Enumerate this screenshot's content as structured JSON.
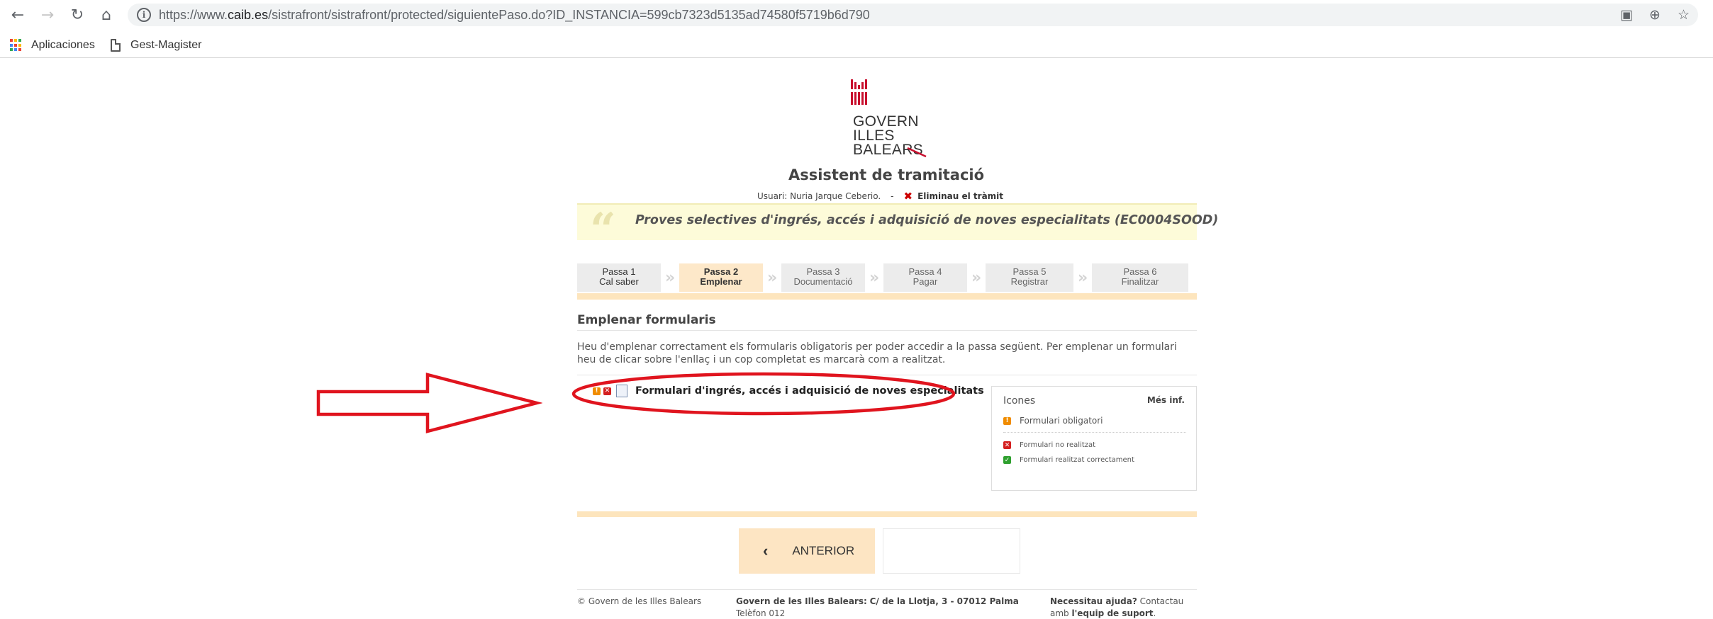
{
  "browser": {
    "url_prefix": "https://www.",
    "url_domain": "caib.es",
    "url_rest": "/sistrafront/sistrafront/protected/siguientePaso.do?ID_INSTANCIA=599cb7323d5135ad74580f5719b6d790",
    "bookmarks": [
      "Aplicaciones",
      "Gest-Magister"
    ]
  },
  "logo": {
    "line1": "GOVERN",
    "line2": "ILLES",
    "line3": "BALEARS"
  },
  "header": {
    "app_title": "Assistent de tramitació",
    "user_label": "Usuari: Nuria Jarque Ceberio.",
    "separator": "-",
    "delete_link": "Eliminau el tràmit"
  },
  "procedure": {
    "title": "Proves selectives d'ingrés, accés i adquisició de noves especialitats (EC0004SOOD)"
  },
  "steps": [
    {
      "line1": "Passa 1",
      "line2": "Cal saber"
    },
    {
      "line1": "Passa 2",
      "line2": "Emplenar"
    },
    {
      "line1": "Passa 3",
      "line2": "Documentació"
    },
    {
      "line1": "Passa 4",
      "line2": "Pagar"
    },
    {
      "line1": "Passa 5",
      "line2": "Registrar"
    },
    {
      "line1": "Passa 6",
      "line2": "Finalitzar"
    }
  ],
  "section": {
    "title": "Emplenar formularis",
    "instructions": "Heu d'emplenar correctament els formularis obligatoris per poder accedir a la passa següent. Per emplenar un formulari heu de clicar sobre l'enllaç i un cop completat es marcarà com a realitzat.",
    "form_link": "Formulari d'ingrés, accés i adquisició de noves especialitats"
  },
  "legend": {
    "title": "Icones",
    "more": "Més inf.",
    "mandatory": "Formulari obligatori",
    "not_done": "Formulari no realitzat",
    "done_ok": "Formulari realitzat correctament"
  },
  "navigation": {
    "back_label": "ANTERIOR"
  },
  "footer": {
    "copyright": "© Govern de les Illes Balears",
    "address_org": "Govern de les Illes Balears:",
    "address_street": "C/ de la Llotja, 3 - 07012 Palma",
    "phone": "Telèfon 012",
    "help_bold": "Necessitau ajuda?",
    "help_text": "Contactau amb",
    "help_link": "l'equip de suport",
    "help_end": "."
  },
  "colors": {
    "accent_orange": "#f08c00",
    "error_red": "#d42020",
    "ok_green": "#2fa02f",
    "annotation_red": "#e0141e",
    "step_active": "#fde8c9",
    "bar_peach": "#fde5bd"
  }
}
